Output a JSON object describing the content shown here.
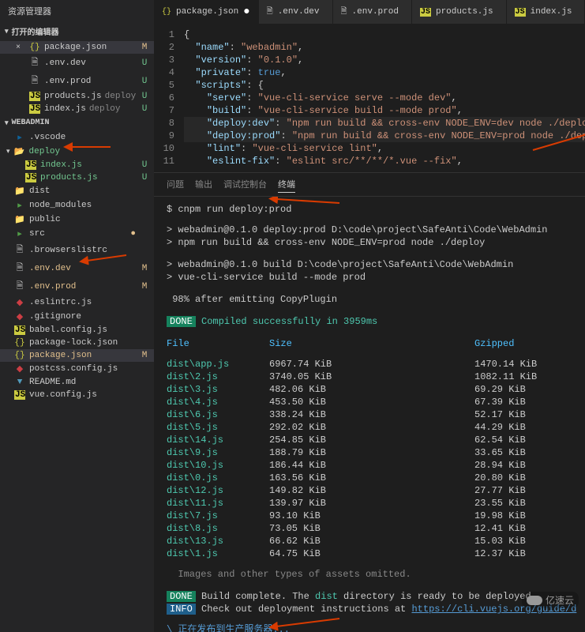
{
  "sidebar": {
    "title": "资源管理器",
    "openEditors": {
      "title": "打开的编辑器",
      "items": [
        {
          "icon": "json",
          "label": "package.json",
          "status": "M",
          "close": true,
          "active": true
        },
        {
          "icon": "file",
          "label": ".env.dev",
          "status": "U"
        },
        {
          "icon": "file",
          "label": ".env.prod",
          "status": "U"
        },
        {
          "icon": "js",
          "label": "products.js",
          "dim": "deploy",
          "status": "U"
        },
        {
          "icon": "js",
          "label": "index.js",
          "dim": "deploy",
          "status": "U"
        }
      ]
    },
    "project": {
      "title": "WEBADMIN",
      "items": [
        {
          "icon": "vscode",
          "label": ".vscode",
          "indent": 0
        },
        {
          "icon": "folder-y",
          "label": "deploy",
          "indent": 0,
          "green": true,
          "chev": true
        },
        {
          "icon": "js",
          "label": "index.js",
          "indent": 1,
          "status": "U",
          "green": true
        },
        {
          "icon": "js",
          "label": "products.js",
          "indent": 1,
          "status": "U",
          "green": true
        },
        {
          "icon": "folder",
          "label": "dist",
          "indent": 0
        },
        {
          "icon": "folder-g",
          "label": "node_modules",
          "indent": 0
        },
        {
          "icon": "folder",
          "label": "public",
          "indent": 0
        },
        {
          "icon": "folder-g",
          "label": "src",
          "indent": 0,
          "dot": true
        },
        {
          "icon": "file",
          "label": ".browserslistrc",
          "indent": 0
        },
        {
          "icon": "file",
          "label": ".env.dev",
          "indent": 0,
          "status": "M",
          "amber": true
        },
        {
          "icon": "file",
          "label": ".env.prod",
          "indent": 0,
          "status": "M",
          "amber": true
        },
        {
          "icon": "red",
          "label": ".eslintrc.js",
          "indent": 0
        },
        {
          "icon": "red",
          "label": ".gitignore",
          "indent": 0
        },
        {
          "icon": "js",
          "label": "babel.config.js",
          "indent": 0
        },
        {
          "icon": "json",
          "label": "package-lock.json",
          "indent": 0
        },
        {
          "icon": "json",
          "label": "package.json",
          "indent": 0,
          "status": "M",
          "amber": true,
          "active": true
        },
        {
          "icon": "red",
          "label": "postcss.config.js",
          "indent": 0
        },
        {
          "icon": "md",
          "label": "README.md",
          "indent": 0
        },
        {
          "icon": "js",
          "label": "vue.config.js",
          "indent": 0
        }
      ]
    }
  },
  "tabs": [
    {
      "icon": "json",
      "label": "package.json",
      "active": true,
      "modified": true
    },
    {
      "icon": "file",
      "label": ".env.dev"
    },
    {
      "icon": "file",
      "label": ".env.prod"
    },
    {
      "icon": "js",
      "label": "products.js"
    },
    {
      "icon": "js",
      "label": "index.js"
    }
  ],
  "code": {
    "lines": [
      {
        "n": 1,
        "t": [
          {
            "c": "c-brace",
            "v": "{"
          }
        ]
      },
      {
        "n": 2,
        "t": [
          {
            "c": "c-punc",
            "v": "  "
          },
          {
            "c": "c-key",
            "v": "\"name\""
          },
          {
            "c": "c-punc",
            "v": ": "
          },
          {
            "c": "c-str",
            "v": "\"webadmin\""
          },
          {
            "c": "c-punc",
            "v": ","
          }
        ]
      },
      {
        "n": 3,
        "t": [
          {
            "c": "c-punc",
            "v": "  "
          },
          {
            "c": "c-key",
            "v": "\"version\""
          },
          {
            "c": "c-punc",
            "v": ": "
          },
          {
            "c": "c-str",
            "v": "\"0.1.0\""
          },
          {
            "c": "c-punc",
            "v": ","
          }
        ]
      },
      {
        "n": 4,
        "t": [
          {
            "c": "c-punc",
            "v": "  "
          },
          {
            "c": "c-key",
            "v": "\"private\""
          },
          {
            "c": "c-punc",
            "v": ": "
          },
          {
            "c": "c-kw",
            "v": "true"
          },
          {
            "c": "c-punc",
            "v": ","
          }
        ]
      },
      {
        "n": 5,
        "t": [
          {
            "c": "c-punc",
            "v": "  "
          },
          {
            "c": "c-key",
            "v": "\"scripts\""
          },
          {
            "c": "c-punc",
            "v": ": {"
          }
        ]
      },
      {
        "n": 6,
        "t": [
          {
            "c": "c-punc",
            "v": "    "
          },
          {
            "c": "c-key",
            "v": "\"serve\""
          },
          {
            "c": "c-punc",
            "v": ": "
          },
          {
            "c": "c-str",
            "v": "\"vue-cli-service serve --mode dev\""
          },
          {
            "c": "c-punc",
            "v": ","
          }
        ]
      },
      {
        "n": 7,
        "t": [
          {
            "c": "c-punc",
            "v": "    "
          },
          {
            "c": "c-key",
            "v": "\"build\""
          },
          {
            "c": "c-punc",
            "v": ": "
          },
          {
            "c": "c-str",
            "v": "\"vue-cli-service build --mode prod\""
          },
          {
            "c": "c-punc",
            "v": ","
          }
        ]
      },
      {
        "n": 8,
        "hl": true,
        "t": [
          {
            "c": "c-punc",
            "v": "    "
          },
          {
            "c": "c-key",
            "v": "\"deploy:dev\""
          },
          {
            "c": "c-punc",
            "v": ": "
          },
          {
            "c": "c-str",
            "v": "\"npm run build && cross-env NODE_ENV=dev node ./deploy\""
          },
          {
            "c": "c-punc",
            "v": ","
          }
        ]
      },
      {
        "n": 9,
        "hl": true,
        "t": [
          {
            "c": "c-punc",
            "v": "    "
          },
          {
            "c": "c-key",
            "v": "\"deploy:prod\""
          },
          {
            "c": "c-punc",
            "v": ": "
          },
          {
            "c": "c-str",
            "v": "\"npm run build && cross-env NODE_ENV=prod node ./deploy\""
          },
          {
            "c": "c-punc",
            "v": ","
          }
        ]
      },
      {
        "n": 10,
        "t": [
          {
            "c": "c-punc",
            "v": "    "
          },
          {
            "c": "c-key",
            "v": "\"lint\""
          },
          {
            "c": "c-punc",
            "v": ": "
          },
          {
            "c": "c-str",
            "v": "\"vue-cli-service lint\""
          },
          {
            "c": "c-punc",
            "v": ","
          }
        ]
      },
      {
        "n": 11,
        "t": [
          {
            "c": "c-punc",
            "v": "    "
          },
          {
            "c": "c-key",
            "v": "\"eslint-fix\""
          },
          {
            "c": "c-punc",
            "v": ": "
          },
          {
            "c": "c-str",
            "v": "\"eslint src/**/**/*.vue --fix\""
          },
          {
            "c": "c-punc",
            "v": ","
          }
        ]
      }
    ]
  },
  "terminalTabs": [
    "问题",
    "输出",
    "调试控制台",
    "终端"
  ],
  "terminalActive": 3,
  "terminal": {
    "prompt": "$ cnpm run deploy:prod",
    "lines1": [
      "> webadmin@0.1.0 deploy:prod D:\\code\\project\\SafeAnti\\Code\\WebAdmin",
      "> npm run build && cross-env NODE_ENV=prod node ./deploy"
    ],
    "lines2": [
      "> webadmin@0.1.0 build D:\\code\\project\\SafeAnti\\Code\\WebAdmin",
      "> vue-cli-service build --mode prod"
    ],
    "progress": " 98% after emitting CopyPlugin",
    "done1": "DONE",
    "done1msg": " Compiled successfully in 3959ms",
    "headers": {
      "file": "File",
      "size": "Size",
      "gzip": "Gzipped"
    },
    "rows": [
      {
        "f": "dist\\app.js",
        "s": "6967.74 KiB",
        "g": "1470.14 KiB"
      },
      {
        "f": "dist\\2.js",
        "s": "3740.05 KiB",
        "g": "1082.11 KiB"
      },
      {
        "f": "dist\\3.js",
        "s": "482.06 KiB",
        "g": "69.29 KiB"
      },
      {
        "f": "dist\\4.js",
        "s": "453.50 KiB",
        "g": "67.39 KiB"
      },
      {
        "f": "dist\\6.js",
        "s": "338.24 KiB",
        "g": "52.17 KiB"
      },
      {
        "f": "dist\\5.js",
        "s": "292.02 KiB",
        "g": "44.29 KiB"
      },
      {
        "f": "dist\\14.js",
        "s": "254.85 KiB",
        "g": "62.54 KiB"
      },
      {
        "f": "dist\\9.js",
        "s": "188.79 KiB",
        "g": "33.65 KiB"
      },
      {
        "f": "dist\\10.js",
        "s": "186.44 KiB",
        "g": "28.94 KiB"
      },
      {
        "f": "dist\\0.js",
        "s": "163.56 KiB",
        "g": "20.80 KiB"
      },
      {
        "f": "dist\\12.js",
        "s": "149.82 KiB",
        "g": "27.77 KiB"
      },
      {
        "f": "dist\\11.js",
        "s": "139.97 KiB",
        "g": "23.55 KiB"
      },
      {
        "f": "dist\\7.js",
        "s": "93.10 KiB",
        "g": "19.98 KiB"
      },
      {
        "f": "dist\\8.js",
        "s": "73.05 KiB",
        "g": "12.41 KiB"
      },
      {
        "f": "dist\\13.js",
        "s": "66.62 KiB",
        "g": "15.03 KiB"
      },
      {
        "f": "dist\\1.js",
        "s": "64.75 KiB",
        "g": "12.37 KiB"
      }
    ],
    "omitted": "  Images and other types of assets omitted.",
    "done2msg": " Build complete. The ",
    "done2dist": "dist",
    "done2msg2": " directory is ready to be deployed.",
    "infomsg": " Check out deployment instructions at ",
    "infolink": "https://cli.vuejs.org/guide/d",
    "deploying": "\\ 正在发布到生产服务器..."
  },
  "watermark": "亿速云"
}
